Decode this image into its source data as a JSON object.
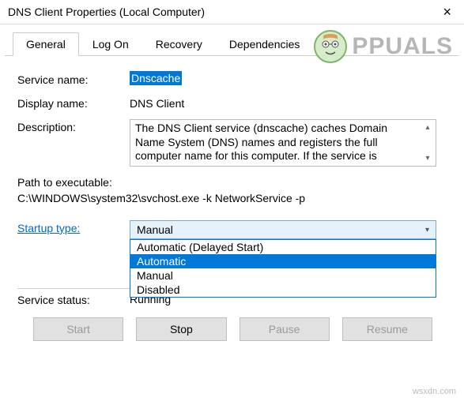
{
  "window": {
    "title": "DNS Client Properties (Local Computer)"
  },
  "brand": {
    "text": "PPUALS"
  },
  "tabs": [
    {
      "label": "General",
      "active": true
    },
    {
      "label": "Log On",
      "active": false
    },
    {
      "label": "Recovery",
      "active": false
    },
    {
      "label": "Dependencies",
      "active": false
    }
  ],
  "fields": {
    "service_name_label": "Service name:",
    "service_name_value": "Dnscache",
    "display_name_label": "Display name:",
    "display_name_value": "DNS Client",
    "description_label": "Description:",
    "description_value": "The DNS Client service (dnscache) caches Domain Name System (DNS) names and registers the full computer name for this computer. If the service is",
    "path_label": "Path to executable:",
    "path_value": "C:\\WINDOWS\\system32\\svchost.exe -k NetworkService -p",
    "startup_label": "Startup type:",
    "startup_selected": "Manual",
    "status_label": "Service status:",
    "status_value": "Running"
  },
  "startup_options": [
    {
      "label": "Automatic (Delayed Start)",
      "selected": false
    },
    {
      "label": "Automatic",
      "selected": true
    },
    {
      "label": "Manual",
      "selected": false
    },
    {
      "label": "Disabled",
      "selected": false
    }
  ],
  "buttons": {
    "start": "Start",
    "stop": "Stop",
    "pause": "Pause",
    "resume": "Resume"
  },
  "watermark": "wsxdn.com"
}
